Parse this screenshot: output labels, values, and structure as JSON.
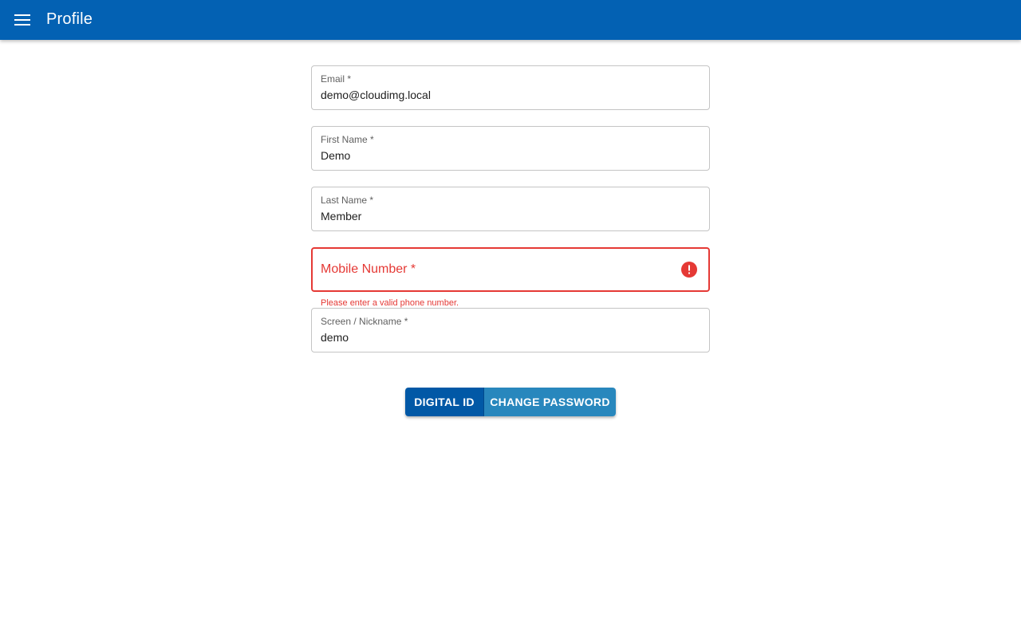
{
  "appbar": {
    "title": "Profile",
    "menu_icon": "menu-icon",
    "background_color": "#0361b3"
  },
  "form": {
    "email": {
      "label": "Email *",
      "value": "demo@cloudimg.local"
    },
    "first_name": {
      "label": "First Name *",
      "value": "Demo"
    },
    "last_name": {
      "label": "Last Name *",
      "value": "Member"
    },
    "mobile": {
      "label": "Mobile Number *",
      "value": "",
      "error_icon": "error-circle-icon",
      "error_text": "Please enter a valid phone number.",
      "error_color": "#e53935"
    },
    "nickname": {
      "label": "Screen / Nickname *",
      "value": "demo"
    }
  },
  "actions": {
    "digital_id_label": "DIGITAL ID",
    "change_password_label": "CHANGE PASSWORD",
    "digital_id_color": "#0158a6",
    "change_password_color": "#2887bd"
  }
}
